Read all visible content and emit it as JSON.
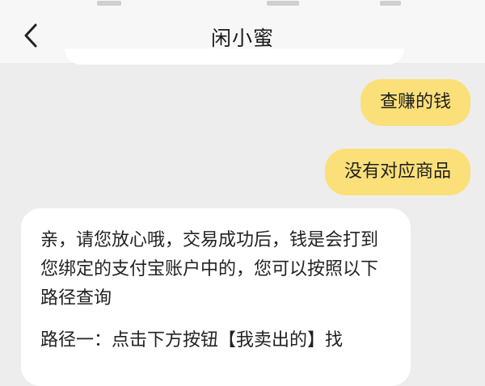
{
  "header": {
    "title": "闲小蜜",
    "back_icon": "chevron-left-icon"
  },
  "messages": {
    "user_1": "查赚的钱",
    "user_2": "没有对应商品",
    "bot_1": {
      "paragraph_1": "亲，请您放心哦，交易成功后，钱是会打到您绑定的支付宝账户中的，您可以按照以下路径查询",
      "paragraph_2": "路径一：点击下方按钮【我卖出的】找"
    }
  },
  "colors": {
    "background": "#ededed",
    "header": "#f7f7f7",
    "user_bubble": "#fbe07a",
    "bot_bubble": "#ffffff"
  }
}
